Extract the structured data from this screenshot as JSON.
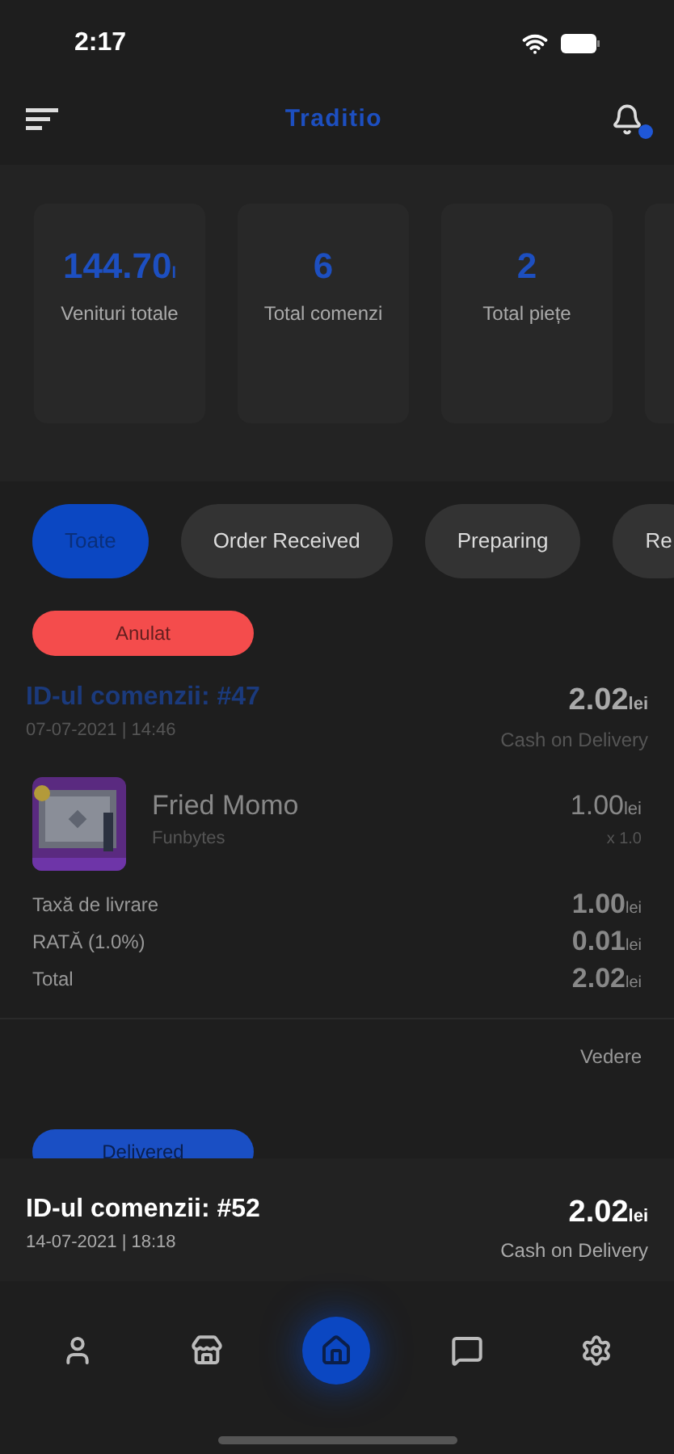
{
  "status_bar": {
    "time": "2:17"
  },
  "header": {
    "title": "Traditio",
    "notification_dot": true
  },
  "stats": [
    {
      "value": "144.70",
      "unit": "l",
      "label": "Venituri totale"
    },
    {
      "value": "6",
      "label": "Total comenzi"
    },
    {
      "value": "2",
      "label": "Total piețe"
    }
  ],
  "filters": [
    {
      "label": "Toate",
      "selected": true
    },
    {
      "label": "Order Received",
      "selected": false
    },
    {
      "label": "Preparing",
      "selected": false
    },
    {
      "label": "Re",
      "selected": false
    }
  ],
  "orders": [
    {
      "status": "Anulat",
      "color": "#f44c4c",
      "title": "ID-ul comenzii: #47",
      "title_highlight": true,
      "date": "07-07-2021 | 14:46",
      "amount": "2.02",
      "currency": "lei",
      "payment": "Cash on Delivery",
      "items": [
        {
          "name": "Fried Momo",
          "store": "Funbytes",
          "price": "1.00",
          "currency": "lei",
          "qty": "x 1.0"
        }
      ],
      "fees": [
        {
          "label": "Taxă de livrare",
          "amount": "1.00",
          "currency": "lei"
        },
        {
          "label": "RATĂ (1.0%)",
          "amount": "0.01",
          "currency": "lei"
        },
        {
          "label": "Total",
          "amount": "2.02",
          "currency": "lei"
        }
      ],
      "action": "Vedere"
    },
    {
      "status": "Delivered",
      "color": "#1a4fc4",
      "title": "ID-ul comenzii: #52",
      "title_highlight": false,
      "date": "14-07-2021 | 18:18",
      "amount": "2.02",
      "currency": "lei",
      "payment": "Cash on Delivery"
    }
  ],
  "nav": [
    {
      "kind": "profile",
      "selected": false
    },
    {
      "kind": "store",
      "selected": false
    },
    {
      "kind": "home",
      "selected": true
    },
    {
      "kind": "chat",
      "selected": false
    },
    {
      "kind": "settings",
      "selected": false
    }
  ]
}
